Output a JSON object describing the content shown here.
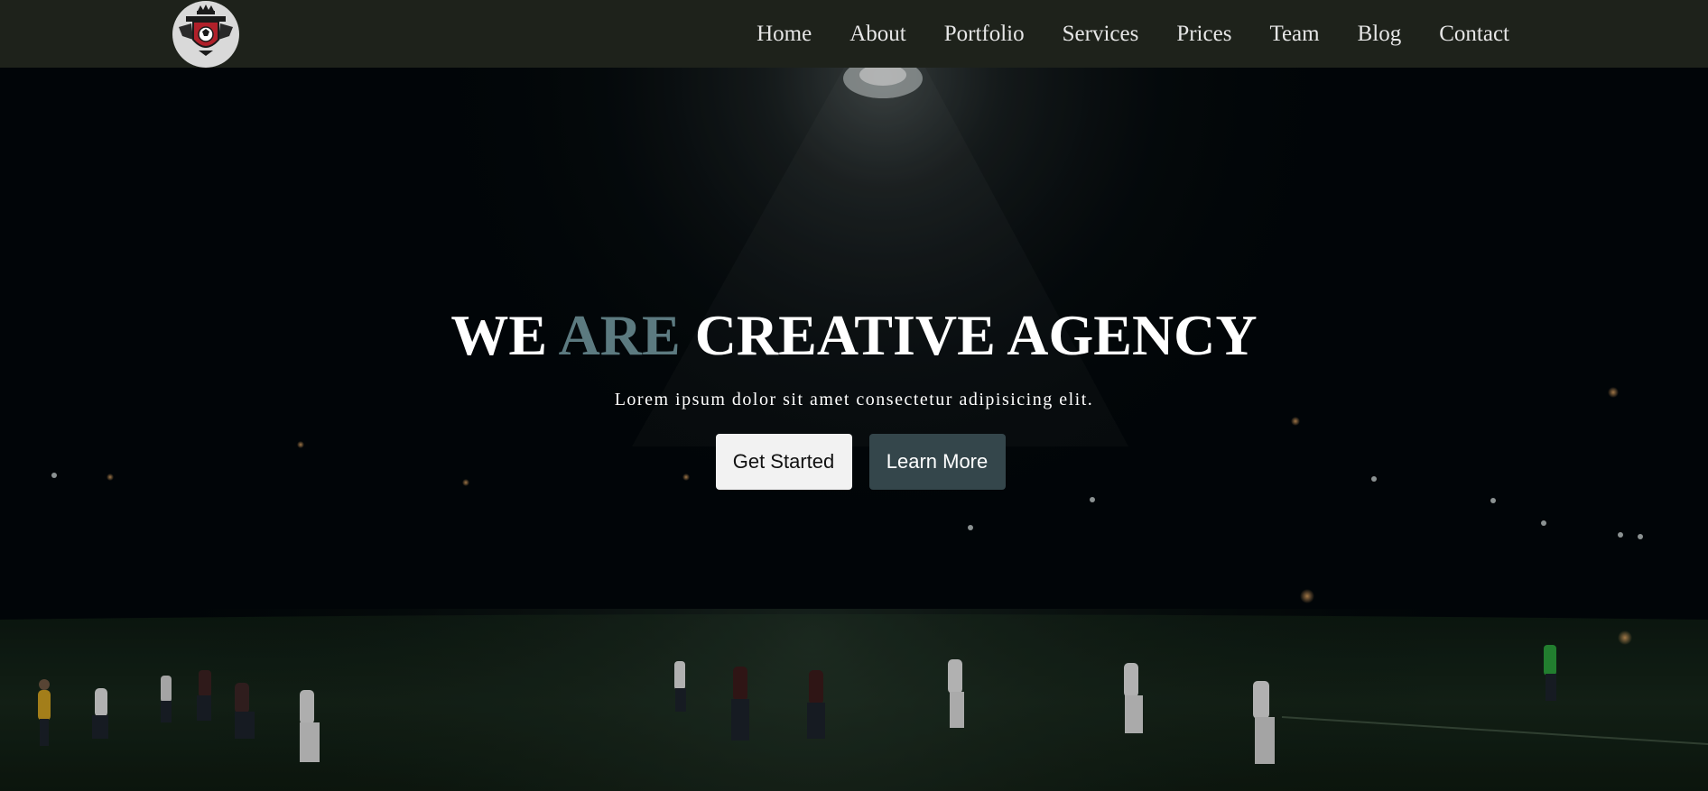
{
  "nav": {
    "logo_icon": "soccer-club-crest-icon",
    "links": [
      "Home",
      "About",
      "Portfolio",
      "Services",
      "Prices",
      "Team",
      "Blog",
      "Contact"
    ]
  },
  "hero": {
    "headline_part1": "WE ",
    "headline_accent": "ARE",
    "headline_part2": " CREATIVE AGENCY",
    "subtitle": "Lorem ipsum dolor sit amet consectetur adipisicing elit.",
    "primary_button": "Get Started",
    "secondary_button": "Learn More"
  },
  "colors": {
    "nav_bg": "#1e221b",
    "accent": "#5c7a80",
    "primary_button_bg": "#f2f2f2",
    "secondary_button_bg": "#34464b"
  }
}
